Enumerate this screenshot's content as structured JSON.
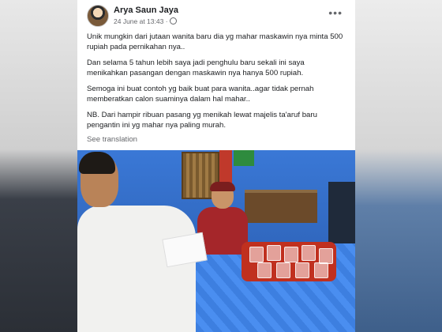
{
  "post": {
    "author": "Arya Saun Jaya",
    "date": "24 June at 13:43 ·",
    "more_icon": "more-horizontal-icon",
    "paragraphs": [
      "Unik mungkin dari jutaan wanita baru dia yg mahar maskawin nya minta 500 rupiah pada pernikahan nya..",
      "Dan selama 5 tahun lebih saya jadi penghulu baru sekali ini saya menikahkan pasangan dengan maskawin nya hanya 500 rupiah.",
      "Semoga ini buat contoh yg baik buat para wanita..agar tidak pernah memberatkan calon suaminya dalam hal mahar..",
      "NB. Dari hampir ribuan pasang yg menikah lewat majelis ta'aruf baru pengantin ini yg mahar nya paling murah."
    ],
    "see_translation": "See translation"
  },
  "colors": {
    "text_primary": "#1c1e21",
    "text_secondary": "#65676b",
    "card_bg": "#ffffff"
  }
}
